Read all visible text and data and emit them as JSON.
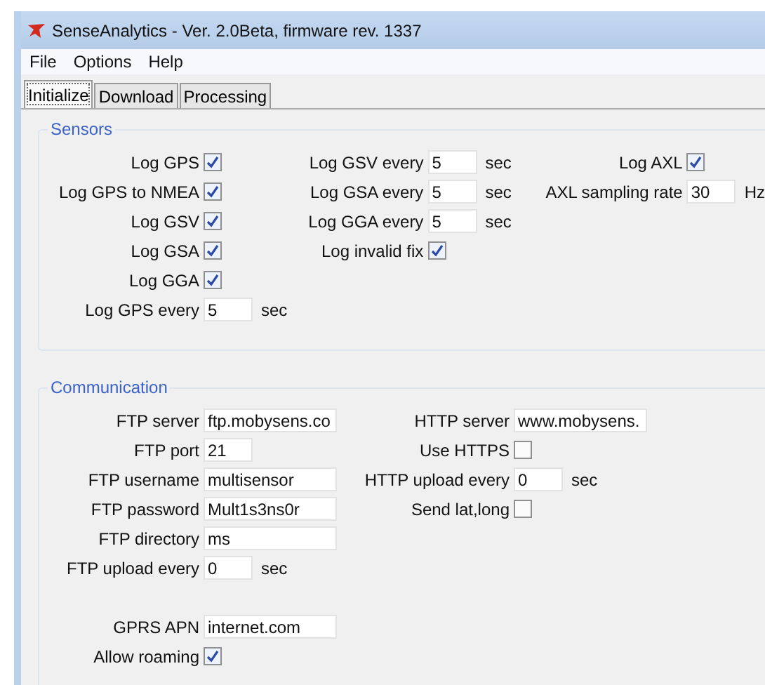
{
  "window": {
    "title": "SenseAnalytics - Ver. 2.0Beta, firmware rev. 1337"
  },
  "menu": [
    "File",
    "Options",
    "Help"
  ],
  "tabs": [
    {
      "label": "Initialize",
      "selected": true
    },
    {
      "label": "Download",
      "selected": false
    },
    {
      "label": "Processing",
      "selected": false
    }
  ],
  "groups": [
    {
      "title": "Sensors",
      "columns": [
        [
          {
            "label": "Log GPS",
            "kind": "check",
            "checked": true
          },
          {
            "label": "Log GPS to NMEA",
            "kind": "check",
            "checked": true
          },
          {
            "label": "Log GSV",
            "kind": "check",
            "checked": true
          },
          {
            "label": "Log GSA",
            "kind": "check",
            "checked": true
          },
          {
            "label": "Log GGA",
            "kind": "check",
            "checked": true
          },
          {
            "label": "Log GPS every",
            "kind": "short",
            "value": "5",
            "unit": "sec"
          }
        ],
        [
          {
            "label": "Log GSV every",
            "kind": "short",
            "value": "5",
            "unit": "sec"
          },
          {
            "label": "Log GSA every",
            "kind": "short",
            "value": "5",
            "unit": "sec"
          },
          {
            "label": "Log GGA every",
            "kind": "short",
            "value": "5",
            "unit": "sec"
          },
          {
            "label": "Log invalid fix",
            "kind": "check",
            "checked": true
          }
        ],
        [
          {
            "label": "Log AXL",
            "kind": "check",
            "checked": true
          },
          {
            "label": "AXL sampling rate",
            "kind": "short",
            "value": "30",
            "unit": "Hz"
          }
        ]
      ]
    },
    {
      "title": "Communication",
      "columns": [
        [
          {
            "label": "FTP server",
            "kind": "long",
            "value": "ftp.mobysens.co"
          },
          {
            "label": "FTP port",
            "kind": "short",
            "value": "21"
          },
          {
            "label": "FTP username",
            "kind": "long",
            "value": "multisensor"
          },
          {
            "label": "FTP password",
            "kind": "long",
            "value": "Mult1s3ns0r"
          },
          {
            "label": "FTP directory",
            "kind": "long",
            "value": "ms"
          },
          {
            "label": "FTP upload every",
            "kind": "short",
            "value": "0",
            "unit": "sec"
          }
        ],
        [
          {
            "label": "HTTP server",
            "kind": "long",
            "value": "www.mobysens."
          },
          {
            "label": "Use HTTPS",
            "kind": "check",
            "checked": false
          },
          {
            "label": "HTTP upload every",
            "kind": "short",
            "value": "0",
            "unit": "sec"
          },
          {
            "label": "Send lat,long",
            "kind": "check",
            "checked": false
          }
        ]
      ],
      "footer": [
        {
          "label": "GPRS APN",
          "kind": "long",
          "value": "internet.com"
        },
        {
          "label": "Allow roaming",
          "kind": "check",
          "checked": true
        }
      ]
    }
  ]
}
